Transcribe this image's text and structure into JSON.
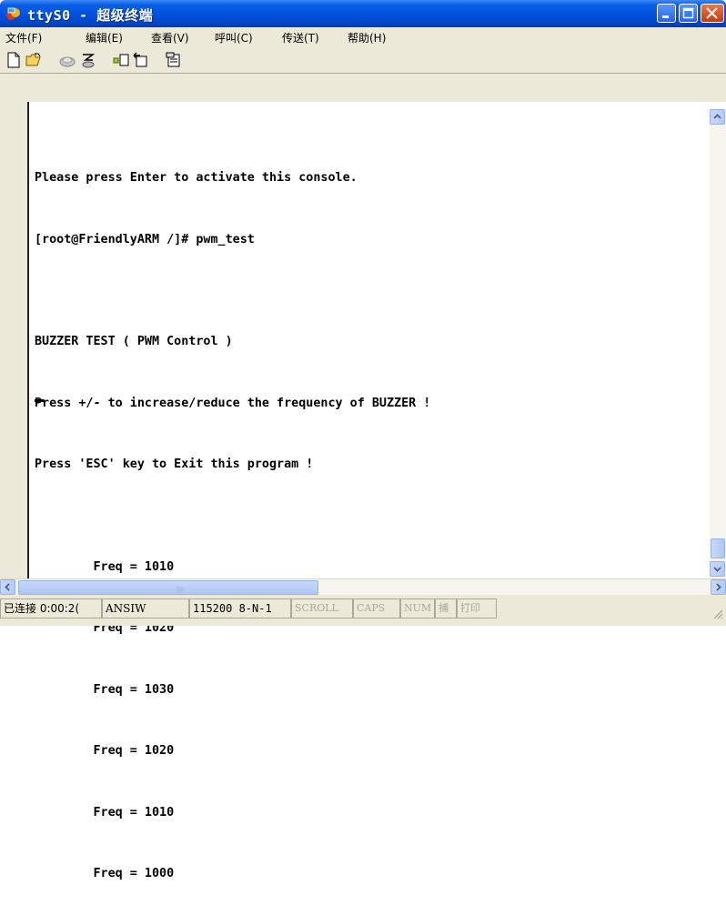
{
  "window": {
    "title": "ttyS0 - 超级终端"
  },
  "menu": {
    "items": [
      "文件(F)",
      "编辑(E)",
      "查看(V)",
      "呼叫(C)",
      "传送(T)",
      "帮助(H)"
    ]
  },
  "toolbar": {
    "icons": [
      "new-connection-icon",
      "open-icon",
      "disconnect-icon",
      "dial-icon",
      "send-icon",
      "receive-icon",
      "properties-icon"
    ]
  },
  "terminal": {
    "lines": [
      "Please press Enter to activate this console.",
      "[root@FriendlyARM /]# pwm_test",
      "",
      "BUZZER TEST ( PWM Control )",
      "Press +/- to increase/reduce the frequency of BUZZER !",
      "Press 'ESC' key to Exit this program !",
      "",
      "        Freq = 1010",
      "        Freq = 1020",
      "        Freq = 1030",
      "        Freq = 1020",
      "        Freq = 1010",
      "        Freq = 1000"
    ]
  },
  "status": {
    "connected": "已连接 0:00:2(",
    "emulation": "ANSIW",
    "port": "115200 8-N-1",
    "scroll": "SCROLL",
    "caps": "CAPS",
    "num": "NUM",
    "capture": "捕",
    "print": "打印"
  }
}
